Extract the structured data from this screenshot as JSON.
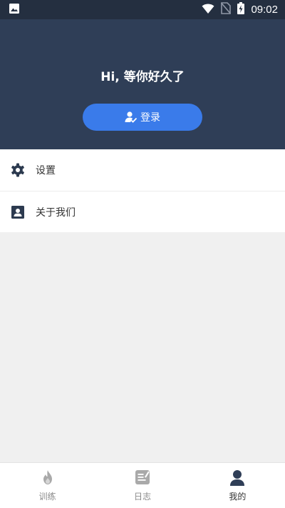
{
  "status_bar": {
    "time": "09:02",
    "icons": [
      "image-icon",
      "wifi-icon",
      "no-sim-icon",
      "battery-charging-icon"
    ]
  },
  "header": {
    "greeting": "Hi, 等你好久了",
    "login_button": {
      "label": "登录",
      "icon": "user-check-icon"
    }
  },
  "menu": {
    "items": [
      {
        "label": "设置",
        "icon": "gear-icon"
      },
      {
        "label": "关于我们",
        "icon": "contact-card-icon"
      }
    ]
  },
  "bottom_nav": {
    "items": [
      {
        "label": "训练",
        "icon": "flame-icon",
        "active": false
      },
      {
        "label": "日志",
        "icon": "notepad-icon",
        "active": false
      },
      {
        "label": "我的",
        "icon": "person-icon",
        "active": true
      }
    ]
  },
  "colors": {
    "status_bar": "#242f40",
    "header": "#2f3e57",
    "accent": "#3a7bea",
    "nav_inactive": "#8a8a8a",
    "nav_active": "#333333"
  }
}
